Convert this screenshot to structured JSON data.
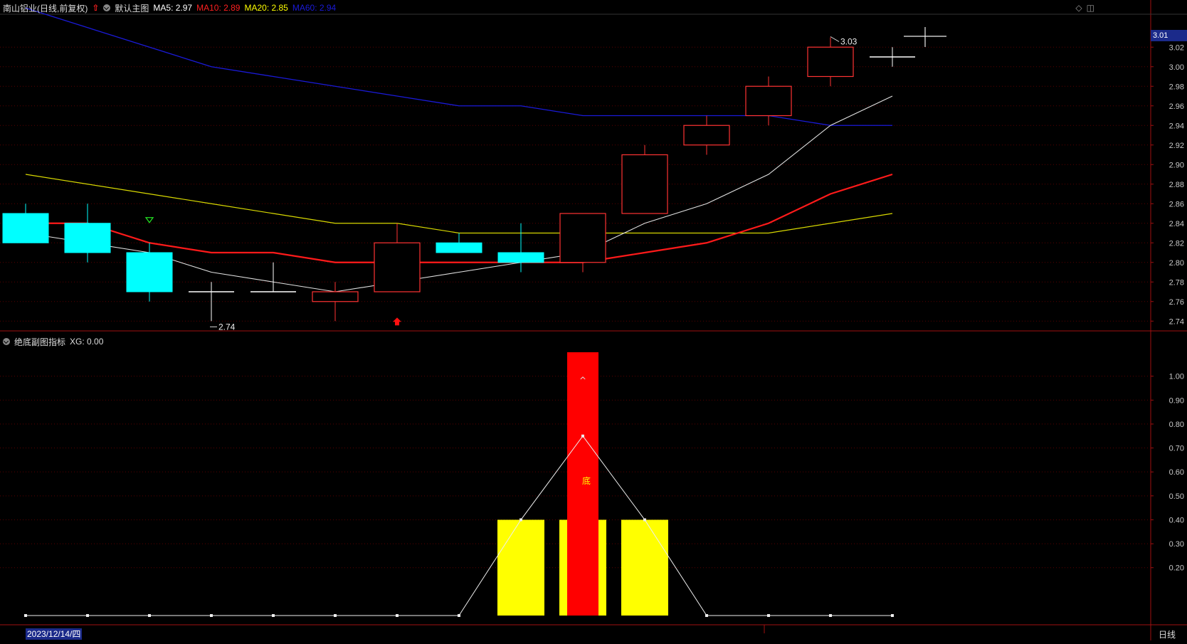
{
  "header": {
    "stock_name": "南山铝业(日线,前复权)",
    "main_chart_label": "默认主图",
    "ma": [
      {
        "label": "MA5:",
        "value": "2.97",
        "color": "#ffffff"
      },
      {
        "label": "MA10:",
        "value": "2.89",
        "color": "#ff2020"
      },
      {
        "label": "MA20:",
        "value": "2.85",
        "color": "#ffff00"
      },
      {
        "label": "MA60:",
        "value": "2.94",
        "color": "#1a1ad8"
      }
    ]
  },
  "sub_header": {
    "indicator_name": "绝底副图指标",
    "xg_label": "XG: 0.00"
  },
  "price_axis": {
    "labels": [
      "3.02",
      "3.00",
      "2.98",
      "2.96",
      "2.94",
      "2.92",
      "2.90",
      "2.88",
      "2.86",
      "2.84",
      "2.82",
      "2.80",
      "2.78",
      "2.76",
      "2.74"
    ],
    "current_price": "3.01"
  },
  "indicator_axis": {
    "labels": [
      "1.00",
      "0.90",
      "0.80",
      "0.70",
      "0.60",
      "0.50",
      "0.40",
      "0.30",
      "0.20"
    ]
  },
  "annotations": {
    "high_label": "3.03",
    "low_label": "2.74",
    "bottom_mark": "底",
    "peak_mark": "^"
  },
  "footer": {
    "date": "2023/12/14/四",
    "period": "日线"
  },
  "colors": {
    "up": "#ff3333",
    "down": "#00ffff",
    "grid": "#5a0000",
    "axis": "#a01010",
    "axis_text": "#c8c8c8",
    "bar_red": "#ff0000",
    "bar_yellow": "#ffff00"
  },
  "chart_data": {
    "type": "candlestick",
    "candles": [
      {
        "o": 2.85,
        "h": 2.86,
        "l": 2.82,
        "c": 2.82
      },
      {
        "o": 2.84,
        "h": 2.86,
        "l": 2.8,
        "c": 2.81
      },
      {
        "o": 2.81,
        "h": 2.82,
        "l": 2.76,
        "c": 2.77
      },
      {
        "o": 2.77,
        "h": 2.78,
        "l": 2.74,
        "c": 2.77
      },
      {
        "o": 2.77,
        "h": 2.8,
        "l": 2.77,
        "c": 2.77
      },
      {
        "o": 2.76,
        "h": 2.78,
        "l": 2.74,
        "c": 2.77
      },
      {
        "o": 2.77,
        "h": 2.84,
        "l": 2.77,
        "c": 2.82
      },
      {
        "o": 2.82,
        "h": 2.83,
        "l": 2.81,
        "c": 2.81
      },
      {
        "o": 2.81,
        "h": 2.84,
        "l": 2.79,
        "c": 2.8
      },
      {
        "o": 2.8,
        "h": 2.85,
        "l": 2.79,
        "c": 2.85
      },
      {
        "o": 2.85,
        "h": 2.92,
        "l": 2.85,
        "c": 2.91
      },
      {
        "o": 2.92,
        "h": 2.95,
        "l": 2.91,
        "c": 2.94
      },
      {
        "o": 2.95,
        "h": 2.99,
        "l": 2.94,
        "c": 2.98
      },
      {
        "o": 2.99,
        "h": 3.03,
        "l": 2.98,
        "c": 3.02
      },
      {
        "o": 3.01,
        "h": 3.02,
        "l": 3.0,
        "c": 3.01
      }
    ],
    "ma5": [
      2.83,
      2.82,
      2.81,
      2.79,
      2.78,
      2.77,
      2.78,
      2.79,
      2.8,
      2.81,
      2.84,
      2.86,
      2.89,
      2.94,
      2.97
    ],
    "ma10": [
      2.84,
      2.84,
      2.82,
      2.81,
      2.81,
      2.8,
      2.8,
      2.8,
      2.8,
      2.8,
      2.81,
      2.82,
      2.84,
      2.87,
      2.89
    ],
    "ma20": [
      2.89,
      2.88,
      2.87,
      2.86,
      2.85,
      2.84,
      2.84,
      2.83,
      2.83,
      2.83,
      2.83,
      2.83,
      2.83,
      2.84,
      2.85
    ],
    "ma60": [
      3.06,
      3.04,
      3.02,
      3.0,
      2.99,
      2.98,
      2.97,
      2.96,
      2.96,
      2.95,
      2.95,
      2.95,
      2.95,
      2.94,
      2.94
    ],
    "indicator": {
      "yellow_bars": [
        0,
        0,
        0,
        0,
        0,
        0,
        0,
        0,
        0.4,
        0.4,
        0.4,
        0,
        0,
        0,
        0
      ],
      "red_bars": [
        0,
        0,
        0,
        0,
        0,
        0,
        0,
        0,
        0,
        1.1,
        0,
        0,
        0,
        0,
        0
      ],
      "white_line": [
        0,
        0,
        0,
        0,
        0,
        0,
        0,
        0,
        0.4,
        0.75,
        0.4,
        0,
        0,
        0,
        0
      ]
    },
    "ylim": [
      2.73,
      3.03
    ],
    "indicator_ylim": [
      0,
      1.1
    ]
  }
}
